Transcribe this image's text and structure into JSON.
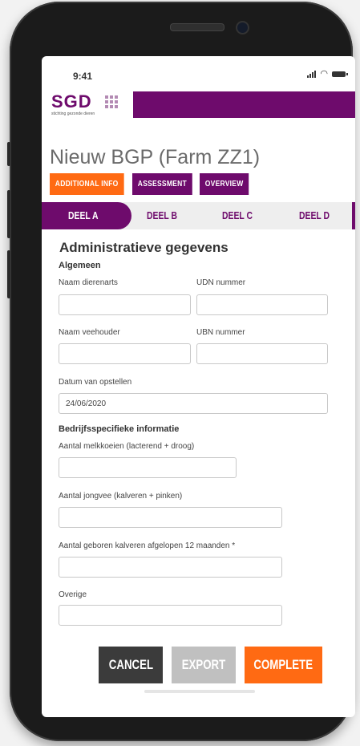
{
  "status": {
    "time": "9:41"
  },
  "brand": {
    "logo_text": "SGD",
    "tagline": "stichting gezonde dieren",
    "color": "#6e0b6c",
    "accent": "#ff6a13"
  },
  "page": {
    "title": "Nieuw BGP (Farm ZZ1)"
  },
  "top_buttons": [
    "ADDITIONAL INFO",
    "ASSESSMENT",
    "OVERVIEW"
  ],
  "tabs": [
    "DEEL A",
    "DEEL B",
    "DEEL C",
    "DEEL D"
  ],
  "active_tab": "DEEL A",
  "form": {
    "title": "Administratieve gegevens",
    "section1": "Algemeen",
    "vet_label": "Naam dierenarts",
    "vet_value": "",
    "udn_label": "UDN nummer",
    "udn_value": "",
    "farmer_label": "Naam veehouder",
    "farmer_value": "",
    "ubn_label": "UBN nummer",
    "ubn_value": "",
    "date_label": "Datum van opstellen",
    "date_value": "24/06/2020",
    "section2": "Bedrijfsspecifieke informatie",
    "cows_label": "Aantal melkkoeien (lacterend + droog)",
    "young_label": "Aantal jongvee (kalveren + pinken)",
    "calves_label": "Aantal geboren kalveren afgelopen 12 maanden *",
    "other_label": "Overige"
  },
  "actions": {
    "cancel": "CANCEL",
    "export": "EXPORT",
    "complete": "COMPLETE"
  },
  "icons": [
    "signal-icon",
    "wifi-icon",
    "battery-icon"
  ]
}
